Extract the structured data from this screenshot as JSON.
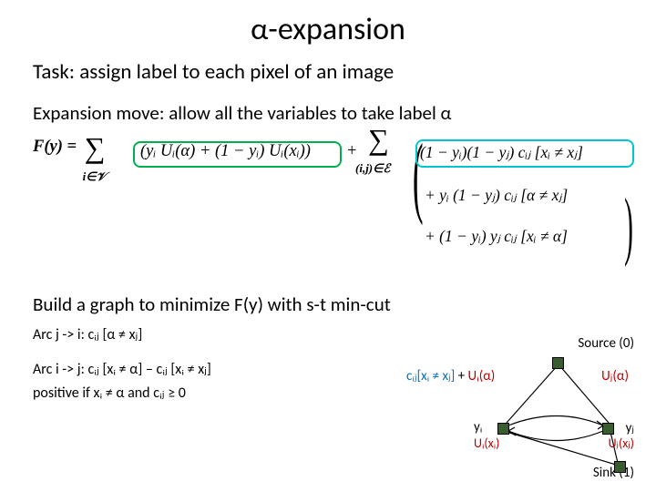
{
  "title": "α-expansion",
  "task_line": "Task: assign label to each pixel of an image",
  "expansion_line": "Expansion move: allow all the variables to take label α",
  "equation": {
    "lhs": "F(y) =",
    "sum1_sub": "i∈𝒱",
    "unary": "(yᵢ Uᵢ(α) + (1 − yᵢ) Uᵢ(xᵢ))",
    "plus": "+",
    "sum2_sub": "(i,j)∈ℰ",
    "pairwise_1": "(1 − yᵢ)(1 − yⱼ) cᵢⱼ [xᵢ ≠ xⱼ]",
    "pairwise_2": "+ yᵢ (1 − yⱼ) cᵢⱼ [α ≠ xⱼ]",
    "pairwise_3": "+ (1 − yᵢ) yⱼ cᵢⱼ [xᵢ ≠ α]"
  },
  "build_line": "Build a graph to minimize F(y) with s-t min-cut",
  "arc_ji": "Arc j -> i:  cᵢⱼ [α ≠ xⱼ]",
  "arc_ij": "Arc i -> j:  cᵢⱼ [xᵢ ≠ α] – cᵢⱼ [xᵢ ≠ xⱼ]",
  "arc_ij_cond": "positive if xᵢ ≠ α and cᵢⱼ ≥ 0",
  "diagram": {
    "source": "Source (0)",
    "sink": "Sink (1)",
    "uj_alpha": "Uⱼ(α)",
    "edge_cij": "cᵢⱼ[xᵢ ≠ xⱼ]",
    "edge_plus": " + ",
    "edge_ui": "Uᵢ(α)",
    "yi": "yᵢ",
    "yj": "yⱼ",
    "ui_xi": "Uᵢ(xᵢ)",
    "uj_xj": "Uⱼ(xⱼ)"
  }
}
